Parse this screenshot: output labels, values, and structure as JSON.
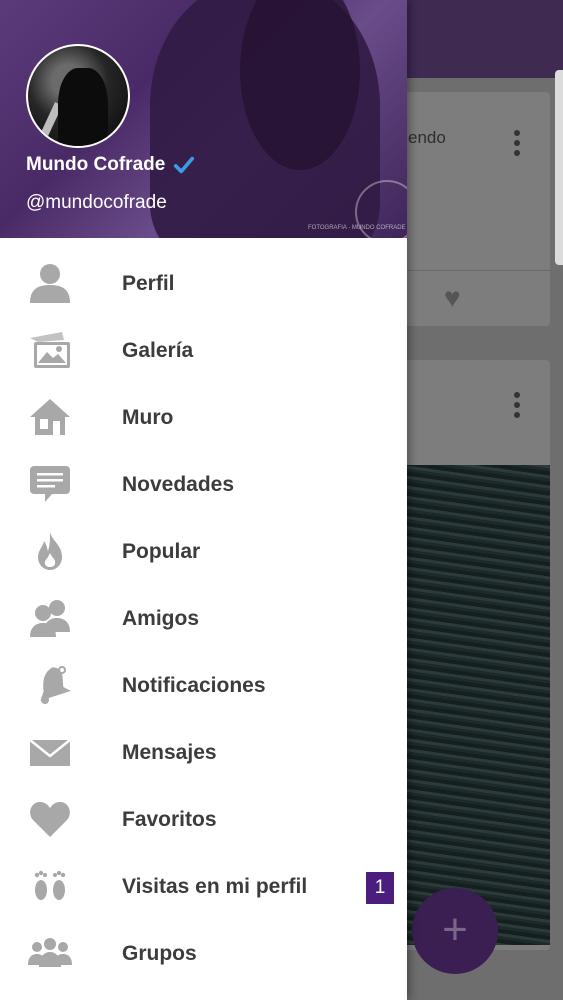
{
  "profile": {
    "name": "Mundo Cofrade",
    "handle": "@mundocofrade",
    "header_watermark": "FOTOGRAFIA · MUNDO COFRADE"
  },
  "menu": [
    {
      "label": "Perfil",
      "icon": "person-icon"
    },
    {
      "label": "Galería",
      "icon": "gallery-icon"
    },
    {
      "label": "Muro",
      "icon": "home-icon"
    },
    {
      "label": "Novedades",
      "icon": "chat-icon"
    },
    {
      "label": "Popular",
      "icon": "flame-icon"
    },
    {
      "label": "Amigos",
      "icon": "friends-icon"
    },
    {
      "label": "Notificaciones",
      "icon": "bell-icon"
    },
    {
      "label": "Mensajes",
      "icon": "envelope-icon"
    },
    {
      "label": "Favoritos",
      "icon": "heart-icon"
    },
    {
      "label": "Visitas en mi perfil",
      "icon": "footprints-icon",
      "badge": "1"
    },
    {
      "label": "Grupos",
      "icon": "groups-icon"
    }
  ],
  "background": {
    "card_text": "endo",
    "fab_symbol": "+"
  },
  "colors": {
    "accent": "#4b1d7c",
    "verified": "#3b9ae1",
    "icon": "#a8a8a8",
    "label": "#3c3c3c"
  }
}
